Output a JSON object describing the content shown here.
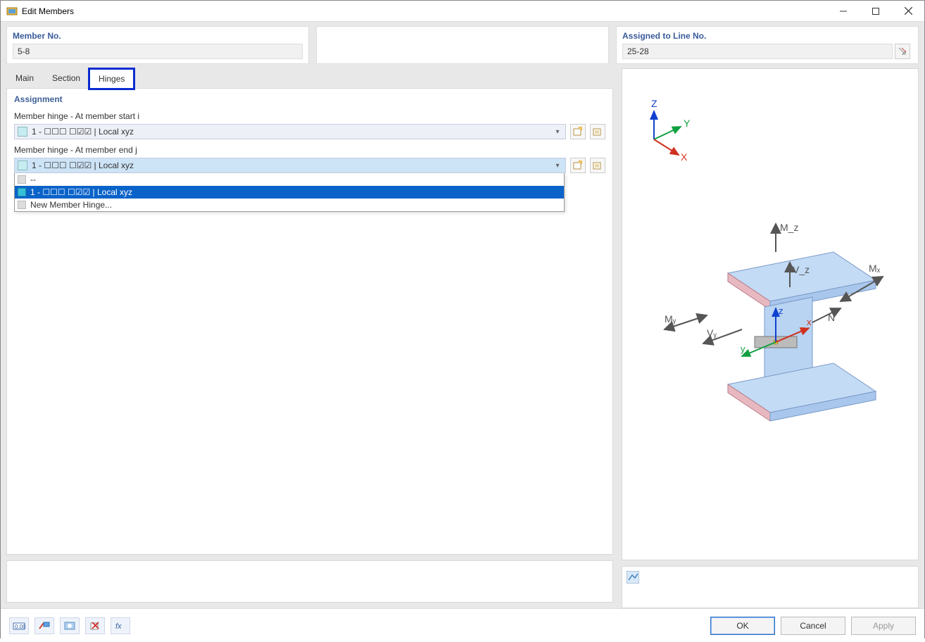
{
  "window": {
    "title": "Edit Members"
  },
  "header": {
    "member_no_label": "Member No.",
    "member_no_value": "5-8",
    "assigned_label": "Assigned to Line No.",
    "assigned_value": "25-28"
  },
  "tabs": {
    "main": "Main",
    "section": "Section",
    "hinges": "Hinges"
  },
  "assignment": {
    "title": "Assignment",
    "start_label": "Member hinge - At member start i",
    "start_value": "1 - ☐☐☐ ☐☑☑ | Local xyz",
    "end_label": "Member hinge - At member end j",
    "end_value": "1 - ☐☐☐ ☐☑☑ | Local xyz",
    "dropdown": {
      "none": "--",
      "opt1": "1 - ☐☐☐ ☐☑☑ | Local xyz",
      "new": "New Member Hinge..."
    }
  },
  "buttons": {
    "ok": "OK",
    "cancel": "Cancel",
    "apply": "Apply"
  },
  "preview": {
    "axes": {
      "x": "X",
      "y": "Y",
      "z": "Z"
    },
    "forces": {
      "mx": "Mₓ",
      "my": "Mᵧ",
      "mz": "M_z",
      "vy": "Vᵧ",
      "vz": "V_z",
      "n": "N"
    },
    "local_axes": {
      "x": "x",
      "y": "y",
      "z": "z"
    }
  }
}
